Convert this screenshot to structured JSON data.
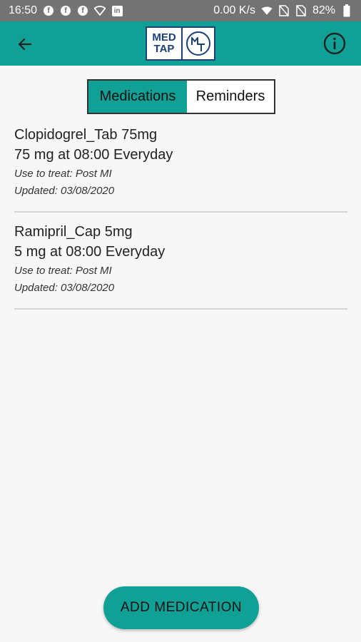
{
  "status_bar": {
    "time": "16:50",
    "speed": "0.00 K/s",
    "battery": "82%",
    "icons": [
      "facebook-icon",
      "facebook-icon",
      "facebook-icon",
      "wifi-icon",
      "linkedin-icon",
      "wifi-icon",
      "no-sim-icon",
      "no-sim-icon",
      "battery-icon"
    ]
  },
  "app_bar": {
    "logo_line1": "MED",
    "logo_line2": "TAP",
    "logo_mark": "MT",
    "back_icon": "arrow-left-icon",
    "info_icon": "info-icon"
  },
  "tabs": [
    {
      "label": "Medications",
      "active": true
    },
    {
      "label": "Reminders",
      "active": false
    }
  ],
  "medications": [
    {
      "name": "Clopidogrel_Tab 75mg",
      "dose": "75 mg at 08:00 Everyday",
      "use": "Use to treat: Post MI",
      "updated": "Updated: 03/08/2020"
    },
    {
      "name": "Ramipril_Cap 5mg",
      "dose": "5 mg at 08:00 Everyday",
      "use": "Use to treat: Post MI",
      "updated": "Updated: 03/08/2020"
    }
  ],
  "add_button": "ADD MEDICATION",
  "colors": {
    "primary": "#10a095",
    "status_bar": "#737373",
    "logo_blue": "#1c3f7a"
  }
}
